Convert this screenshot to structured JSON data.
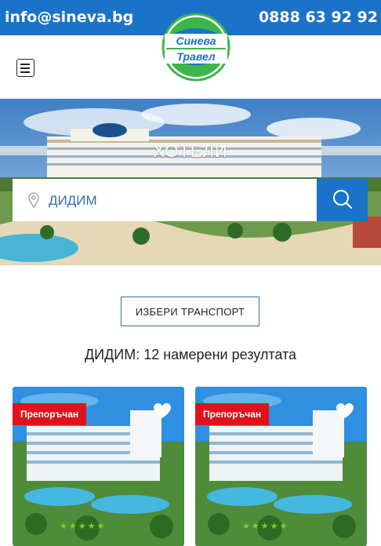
{
  "topbar": {
    "email": "info@sineva.bg",
    "phone": "0888 63 92 92"
  },
  "logo": {
    "line1": "Синева",
    "line2": "Травел"
  },
  "hero": {
    "title": "ХОТЕЛИ"
  },
  "search": {
    "value": "ДИДИМ"
  },
  "transport_button": "ИЗБЕРИ ТРАНСПОРТ",
  "results_text": "ДИДИМ: 12 намерени резултата",
  "cards": [
    {
      "badge": "Препоръчан",
      "stars": "★★★★★"
    },
    {
      "badge": "Препоръчан",
      "stars": "★★★★★"
    }
  ],
  "colors": {
    "brand_blue": "#1a73c8",
    "badge_red": "#e0121b",
    "logo_green": "#3cb54a"
  },
  "icons": {
    "menu": "hamburger-icon",
    "location": "map-pin-icon",
    "search": "search-icon",
    "favorite": "heart-icon"
  }
}
